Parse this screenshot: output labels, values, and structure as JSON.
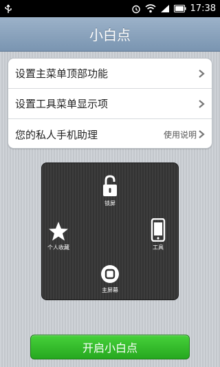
{
  "status_bar": {
    "time": "17:38",
    "icons": [
      "usb-icon",
      "alarm-icon",
      "wifi-icon",
      "signal-icon",
      "battery-icon"
    ]
  },
  "header": {
    "title": "小白点"
  },
  "settings": {
    "items": [
      {
        "label": "设置主菜单顶部功能"
      },
      {
        "label": "设置工具菜单显示项"
      },
      {
        "label": "您的私人手机助理",
        "link": "使用说明"
      }
    ]
  },
  "panel": {
    "items": [
      {
        "label": "锁屏",
        "icon": "lock-icon"
      },
      {
        "label": "个人收藏",
        "icon": "star-icon"
      },
      {
        "label": "工具",
        "icon": "phone-icon"
      },
      {
        "label": "主屏幕",
        "icon": "home-button-icon"
      }
    ]
  },
  "action": {
    "label": "开启小白点"
  },
  "colors": {
    "accent": "#2fb626",
    "header": "#869fba",
    "panel": "#383838"
  }
}
